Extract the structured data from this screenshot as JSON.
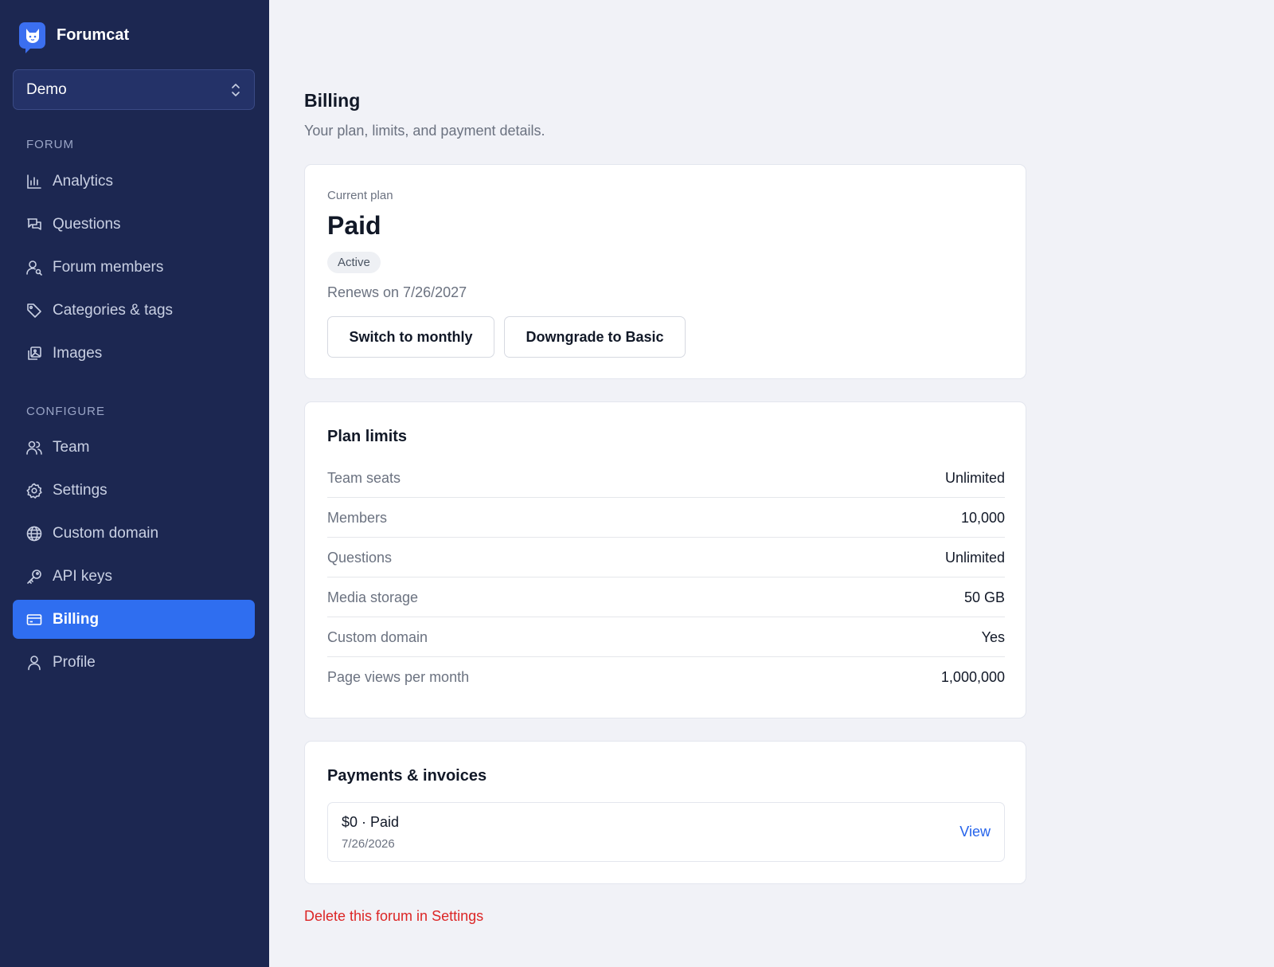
{
  "sidebar": {
    "brand": "Forumcat",
    "workspace": "Demo",
    "sections": {
      "forum": "FORUM",
      "configure": "CONFIGURE"
    },
    "forum_items": [
      {
        "label": "Analytics",
        "icon": "bar-chart-icon"
      },
      {
        "label": "Questions",
        "icon": "chat-bubbles-icon"
      },
      {
        "label": "Forum members",
        "icon": "user-search-icon"
      },
      {
        "label": "Categories & tags",
        "icon": "tag-icon"
      },
      {
        "label": "Images",
        "icon": "image-stack-icon"
      }
    ],
    "configure_items": [
      {
        "label": "Team",
        "icon": "users-icon"
      },
      {
        "label": "Settings",
        "icon": "gear-icon"
      },
      {
        "label": "Custom domain",
        "icon": "globe-icon"
      },
      {
        "label": "API keys",
        "icon": "key-icon"
      },
      {
        "label": "Billing",
        "icon": "credit-card-icon",
        "active": true
      },
      {
        "label": "Profile",
        "icon": "user-icon"
      }
    ]
  },
  "page": {
    "title": "Billing",
    "subtitle": "Your plan, limits, and payment details."
  },
  "plan": {
    "kicker": "Current plan",
    "name": "Paid",
    "status": "Active",
    "renewal": "Renews on 7/26/2027",
    "switch_button": "Switch to monthly",
    "downgrade_button": "Downgrade to Basic"
  },
  "limits": {
    "title": "Plan limits",
    "rows": [
      {
        "label": "Team seats",
        "value": "Unlimited"
      },
      {
        "label": "Members",
        "value": "10,000"
      },
      {
        "label": "Questions",
        "value": "Unlimited"
      },
      {
        "label": "Media storage",
        "value": "50 GB"
      },
      {
        "label": "Custom domain",
        "value": "Yes"
      },
      {
        "label": "Page views per month",
        "value": "1,000,000"
      }
    ]
  },
  "payments": {
    "title": "Payments & invoices",
    "invoices": [
      {
        "amount": "$0 · Paid",
        "date": "7/26/2026",
        "action": "View"
      }
    ]
  },
  "danger": {
    "delete_link": "Delete this forum in Settings"
  },
  "colors": {
    "sidebar_bg": "#1c2751",
    "accent": "#2f6ef0",
    "link": "#2563eb",
    "danger": "#dc2626"
  }
}
